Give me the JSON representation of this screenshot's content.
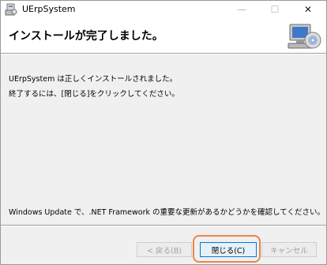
{
  "window": {
    "title": "UErpSystem",
    "controls": {
      "minimize": "—",
      "maximize": "☐",
      "close": "✕"
    }
  },
  "banner": {
    "heading": "インストールが完了しました。",
    "graphic": "computer-cd-icon"
  },
  "messages": {
    "line1": "UErpSystem は正しくインストールされました。",
    "line2": "終了するには、[閉じる]をクリックしてください。",
    "line3": "Windows Update で、.NET Framework の重要な更新があるかどうかを確認してください。"
  },
  "buttons": {
    "back": "< 戻る(B)",
    "close": "閉じる(C)",
    "cancel": "キャンセル"
  },
  "colors": {
    "focus_highlight": "#e8874a",
    "default_button_border": "#0078d7"
  }
}
